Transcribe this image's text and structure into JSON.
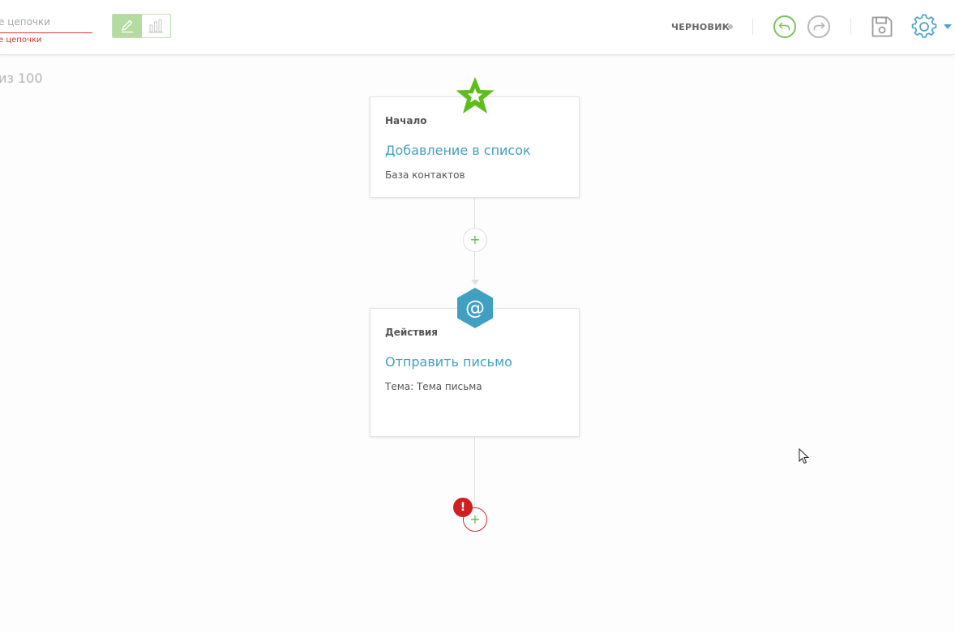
{
  "header": {
    "name_placeholder": "е цепочки",
    "name_error": "е цепочки",
    "status": "ЧЕРНОВИК",
    "icons": {
      "edit": "pencil-icon",
      "stats": "bar-chart-icon",
      "undo": "undo-icon",
      "redo": "redo-icon",
      "save": "save-icon",
      "settings": "gear-icon"
    }
  },
  "counter": "из 100",
  "flow": {
    "start": {
      "label": "Начало",
      "title": "Добавление в список",
      "subtitle": "База контактов",
      "icon": "star-icon"
    },
    "action": {
      "label": "Действия",
      "title": "Отправить письмо",
      "subtitle": "Тема: Тема письма",
      "icon": "at-sign-icon",
      "icon_glyph": "@"
    },
    "add_symbol": "+",
    "error_symbol": "!"
  },
  "colors": {
    "accent_green": "#66bd45",
    "accent_blue": "#41a0c2",
    "error_red": "#cf1f1f"
  }
}
